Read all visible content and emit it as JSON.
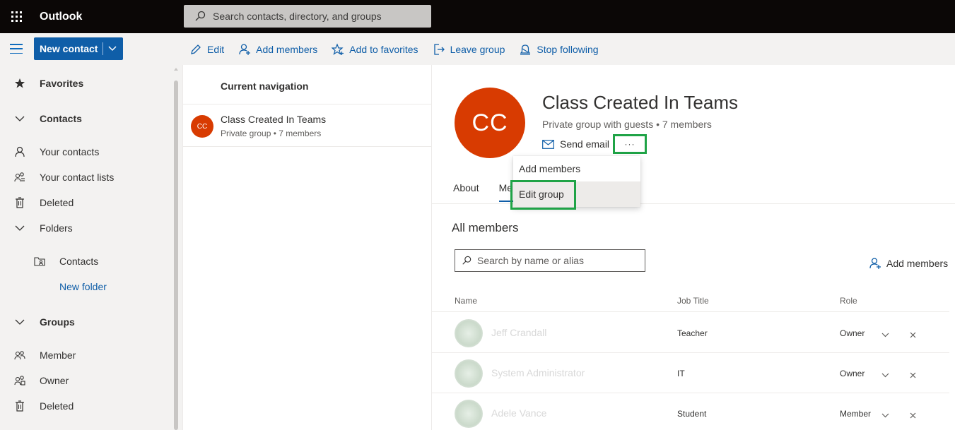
{
  "app": {
    "title": "Outlook"
  },
  "search": {
    "placeholder": "Search contacts, directory, and groups"
  },
  "command_bar": {
    "new_contact": "New contact",
    "items": [
      {
        "label": "Edit",
        "icon": "pencil-icon"
      },
      {
        "label": "Add members",
        "icon": "add-person-icon"
      },
      {
        "label": "Add to favorites",
        "icon": "star-add-icon"
      },
      {
        "label": "Leave group",
        "icon": "leave-icon"
      },
      {
        "label": "Stop following",
        "icon": "stop-following-icon"
      }
    ]
  },
  "nav": {
    "favorites": "Favorites",
    "contacts": "Contacts",
    "your_contacts": "Your contacts",
    "your_contact_lists": "Your contact lists",
    "deleted": "Deleted",
    "folders": "Folders",
    "folder_contacts": "Contacts",
    "new_folder": "New folder",
    "groups": "Groups",
    "member": "Member",
    "owner": "Owner",
    "groups_deleted": "Deleted"
  },
  "list": {
    "header": "Current navigation",
    "item": {
      "initials": "CC",
      "name": "Class Created In Teams",
      "sub": "Private group • 7 members"
    }
  },
  "detail": {
    "initials": "CC",
    "name": "Class Created In Teams",
    "sub": "Private group with guests • 7 members",
    "send_email": "Send email",
    "more": "···",
    "tabs": [
      "About",
      "Members"
    ],
    "all_members": "All members",
    "member_search_placeholder": "Search by name or alias",
    "add_members": "Add members",
    "columns": {
      "name": "Name",
      "job_title": "Job Title",
      "role": "Role"
    },
    "members": [
      {
        "name": "Jeff Crandall",
        "job": "Teacher",
        "role": "Owner"
      },
      {
        "name": "System Administrator",
        "job": "IT",
        "role": "Owner"
      },
      {
        "name": "Adele Vance",
        "job": "Student",
        "role": "Member"
      }
    ]
  },
  "context_menu": {
    "items": [
      "Add members",
      "Edit group"
    ]
  },
  "colors": {
    "accent": "#0f5ea8",
    "avatar": "#d83b01",
    "highlight": "#1fa346",
    "topbar": "#0b0706"
  }
}
